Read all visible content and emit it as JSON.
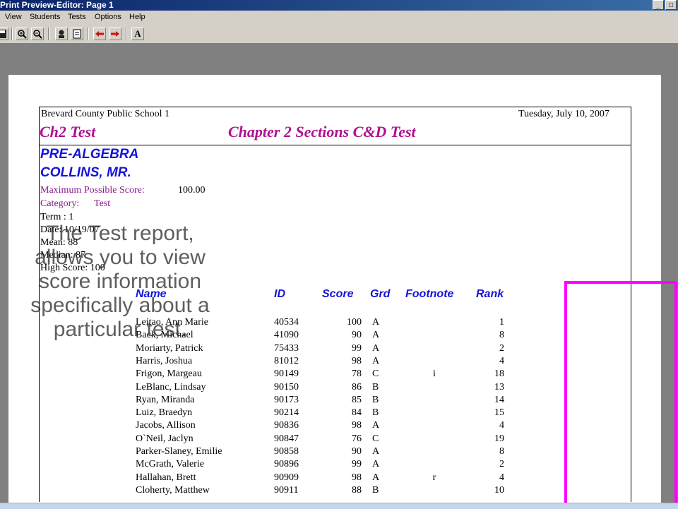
{
  "window": {
    "title": "Print Preview-Editor:   Page 1"
  },
  "menu": {
    "items": [
      "View",
      "Students",
      "Tests",
      "Options",
      "Help"
    ]
  },
  "toolbar": {
    "font_button_label": "A"
  },
  "report": {
    "school": "Brevard County Public School 1",
    "date": "Tuesday, July 10, 2007",
    "test_code": "Ch2 Test",
    "test_title": "Chapter 2 Sections C&D Test",
    "course": "PRE-ALGEBRA",
    "teacher": "COLLINS, MR.",
    "max_score_label": "Maximum Possible Score:",
    "max_score_value": "100.00",
    "category_label": "Category:",
    "category_value": "Test",
    "term": "Term : 1",
    "test_date": "Date: 10/19/07",
    "mean": "Mean: 88",
    "median": "Median: 87",
    "high_score": "High Score: 100",
    "columns": [
      "Name",
      "ID",
      "Score",
      "Grd",
      "Footnote",
      "Rank"
    ],
    "rows": [
      {
        "name": "Leitao, Ann Marie",
        "id": "40534",
        "score": "100",
        "grd": "A",
        "foot": "",
        "rank": "1"
      },
      {
        "name": "Back, Michael",
        "id": "41090",
        "score": "90",
        "grd": "A",
        "foot": "",
        "rank": "8"
      },
      {
        "name": "Moriarty, Patrick",
        "id": "75433",
        "score": "99",
        "grd": "A",
        "foot": "",
        "rank": "2"
      },
      {
        "name": "Harris, Joshua",
        "id": "81012",
        "score": "98",
        "grd": "A",
        "foot": "",
        "rank": "4"
      },
      {
        "name": "Frigon, Margeau",
        "id": "90149",
        "score": "78",
        "grd": "C",
        "foot": "i",
        "rank": "18"
      },
      {
        "name": "LeBlanc, Lindsay",
        "id": "90150",
        "score": "86",
        "grd": "B",
        "foot": "",
        "rank": "13"
      },
      {
        "name": "Ryan, Miranda",
        "id": "90173",
        "score": "85",
        "grd": "B",
        "foot": "",
        "rank": "14"
      },
      {
        "name": "Luiz, Braedyn",
        "id": "90214",
        "score": "84",
        "grd": "B",
        "foot": "",
        "rank": "15"
      },
      {
        "name": "Jacobs, Allison",
        "id": "90836",
        "score": "98",
        "grd": "A",
        "foot": "",
        "rank": "4"
      },
      {
        "name": "O`Neil, Jaclyn",
        "id": "90847",
        "score": "76",
        "grd": "C",
        "foot": "",
        "rank": "19"
      },
      {
        "name": "Parker-Slaney, Emilie",
        "id": "90858",
        "score": "90",
        "grd": "A",
        "foot": "",
        "rank": "8"
      },
      {
        "name": "McGrath, Valerie",
        "id": "90896",
        "score": "99",
        "grd": "A",
        "foot": "",
        "rank": "2"
      },
      {
        "name": "Hallahan, Brett",
        "id": "90909",
        "score": "98",
        "grd": "A",
        "foot": "r",
        "rank": "4"
      },
      {
        "name": "Cloherty, Matthew",
        "id": "90911",
        "score": "88",
        "grd": "B",
        "foot": "",
        "rank": "10"
      }
    ]
  },
  "annotation": {
    "text": "The Test report, allows you to view score information specifically about a particular test."
  },
  "colors": {
    "highlight": "#ff00ff",
    "title_magenta": "#b0108f",
    "heading_blue": "#1414d8"
  }
}
